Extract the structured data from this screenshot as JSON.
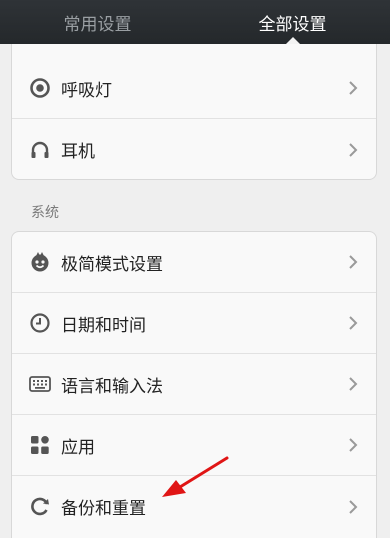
{
  "tabs": [
    {
      "label": "常用设置",
      "active": false
    },
    {
      "label": "全部设置",
      "active": true
    }
  ],
  "top_group": {
    "items": [
      {
        "label": "呼吸灯",
        "icon": "breathing-light-icon"
      },
      {
        "label": "耳机",
        "icon": "headphones-icon"
      }
    ]
  },
  "system_section": {
    "title": "系统",
    "items": [
      {
        "label": "极简模式设置",
        "icon": "simple-mode-icon"
      },
      {
        "label": "日期和时间",
        "icon": "clock-icon"
      },
      {
        "label": "语言和输入法",
        "icon": "keyboard-icon"
      },
      {
        "label": "应用",
        "icon": "apps-icon"
      },
      {
        "label": "备份和重置",
        "icon": "backup-reset-icon"
      }
    ]
  },
  "colors": {
    "tabbar": "#24282b",
    "icon": "#555555",
    "annotation_arrow": "#e01515"
  }
}
